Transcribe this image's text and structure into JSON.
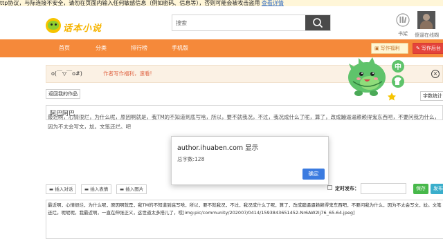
{
  "warning": {
    "text": "ttp协议，与际连接不安全，请勿在页面内输入任何敏感信息（例如密码、信息等），否则可能会被攻击盗用",
    "link": "查看详情"
  },
  "header": {
    "logo_text": "话本小说",
    "search_placeholder": "搜索",
    "shelf_label": "书架",
    "user_label": "傻逼在线糊"
  },
  "nav": {
    "items": [
      "首页",
      "分类",
      "排行榜",
      "手机版"
    ],
    "welfare_label": "写作福利",
    "backend_label": "写作后台"
  },
  "notice": {
    "face": "o(￣▽￣o#)",
    "text": "作者写作福利，速看!",
    "close": "×"
  },
  "toolbar": {
    "back_label": "返回我的作品",
    "word_count_label": "字数统计"
  },
  "title_value": "阿巴阿巴",
  "content_preview": "最近啊，心情很烂，为什么呢，原因啊就是，我TM的不知道到底写啥，所以，要不就我况，不过，我况成什么了呢，算了，改成蹦逼逼赖赖得鬼东西吧，不要问我为什么，因为不太会写文，尬。文笔还烂。吧",
  "editor_tools": {
    "dialog_label": "插入对话",
    "emoji_label": "插入表情",
    "image_label": "插入图片"
  },
  "schedule": {
    "label": "定时发布：",
    "value": ""
  },
  "actions": {
    "save_label": "保存",
    "publish_label": "发布"
  },
  "editor_text": "最近啊，心情很烂，为什么呢，原因啊就是，我TM的不知道到底写啥，所以，要不就我况，不过，我况成什么了呢，算了，改成蹦逼逼赖赖得鬼东西吧，不要问我为什么，因为不太会写文，尬。文笔还烂。呢呢呢，我最近啊，一直在伸张正义，这世道太多搭儿了，哎[img:pic/community/202007/0414/1593843651452-Nr6AW2Ij76_65-64.jpeg]",
  "dialog": {
    "title": "author.ihuaben.com 显示",
    "message": "总字数:128",
    "ok_label": "确定"
  },
  "colors": {
    "nav_bg": "#f5893a",
    "backend_btn": "#e4433b",
    "save_btn": "#47b84a",
    "publish_btn": "#3aaecb",
    "ok_btn": "#3b7be0",
    "notice_text": "#e06a4a"
  },
  "icons": [
    "search-icon",
    "bookshelf-icon",
    "avatar",
    "close-icon",
    "mascot",
    "dialog-icon",
    "emoji-icon",
    "image-icon"
  ]
}
